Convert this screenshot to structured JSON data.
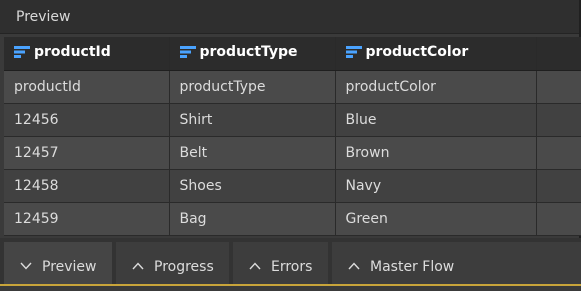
{
  "panel": {
    "title": "Preview"
  },
  "table": {
    "columns": [
      "productId",
      "productType",
      "productColor"
    ],
    "rows": [
      [
        "productId",
        "productType",
        "productColor"
      ],
      [
        "12456",
        "Shirt",
        "Blue"
      ],
      [
        "12457",
        "Belt",
        "Brown"
      ],
      [
        "12458",
        "Shoes",
        "Navy"
      ],
      [
        "12459",
        "Bag",
        "Green"
      ]
    ]
  },
  "tabs": [
    {
      "label": "Preview",
      "icon": "chevron-down-icon",
      "active": true
    },
    {
      "label": "Progress",
      "icon": "chevron-up-icon",
      "active": false
    },
    {
      "label": "Errors",
      "icon": "chevron-up-icon",
      "active": false
    },
    {
      "label": "Master Flow",
      "icon": "chevron-up-icon",
      "active": false
    }
  ],
  "colors": {
    "accent": "#c8a43a",
    "column_icon": "#4aa3ff"
  }
}
